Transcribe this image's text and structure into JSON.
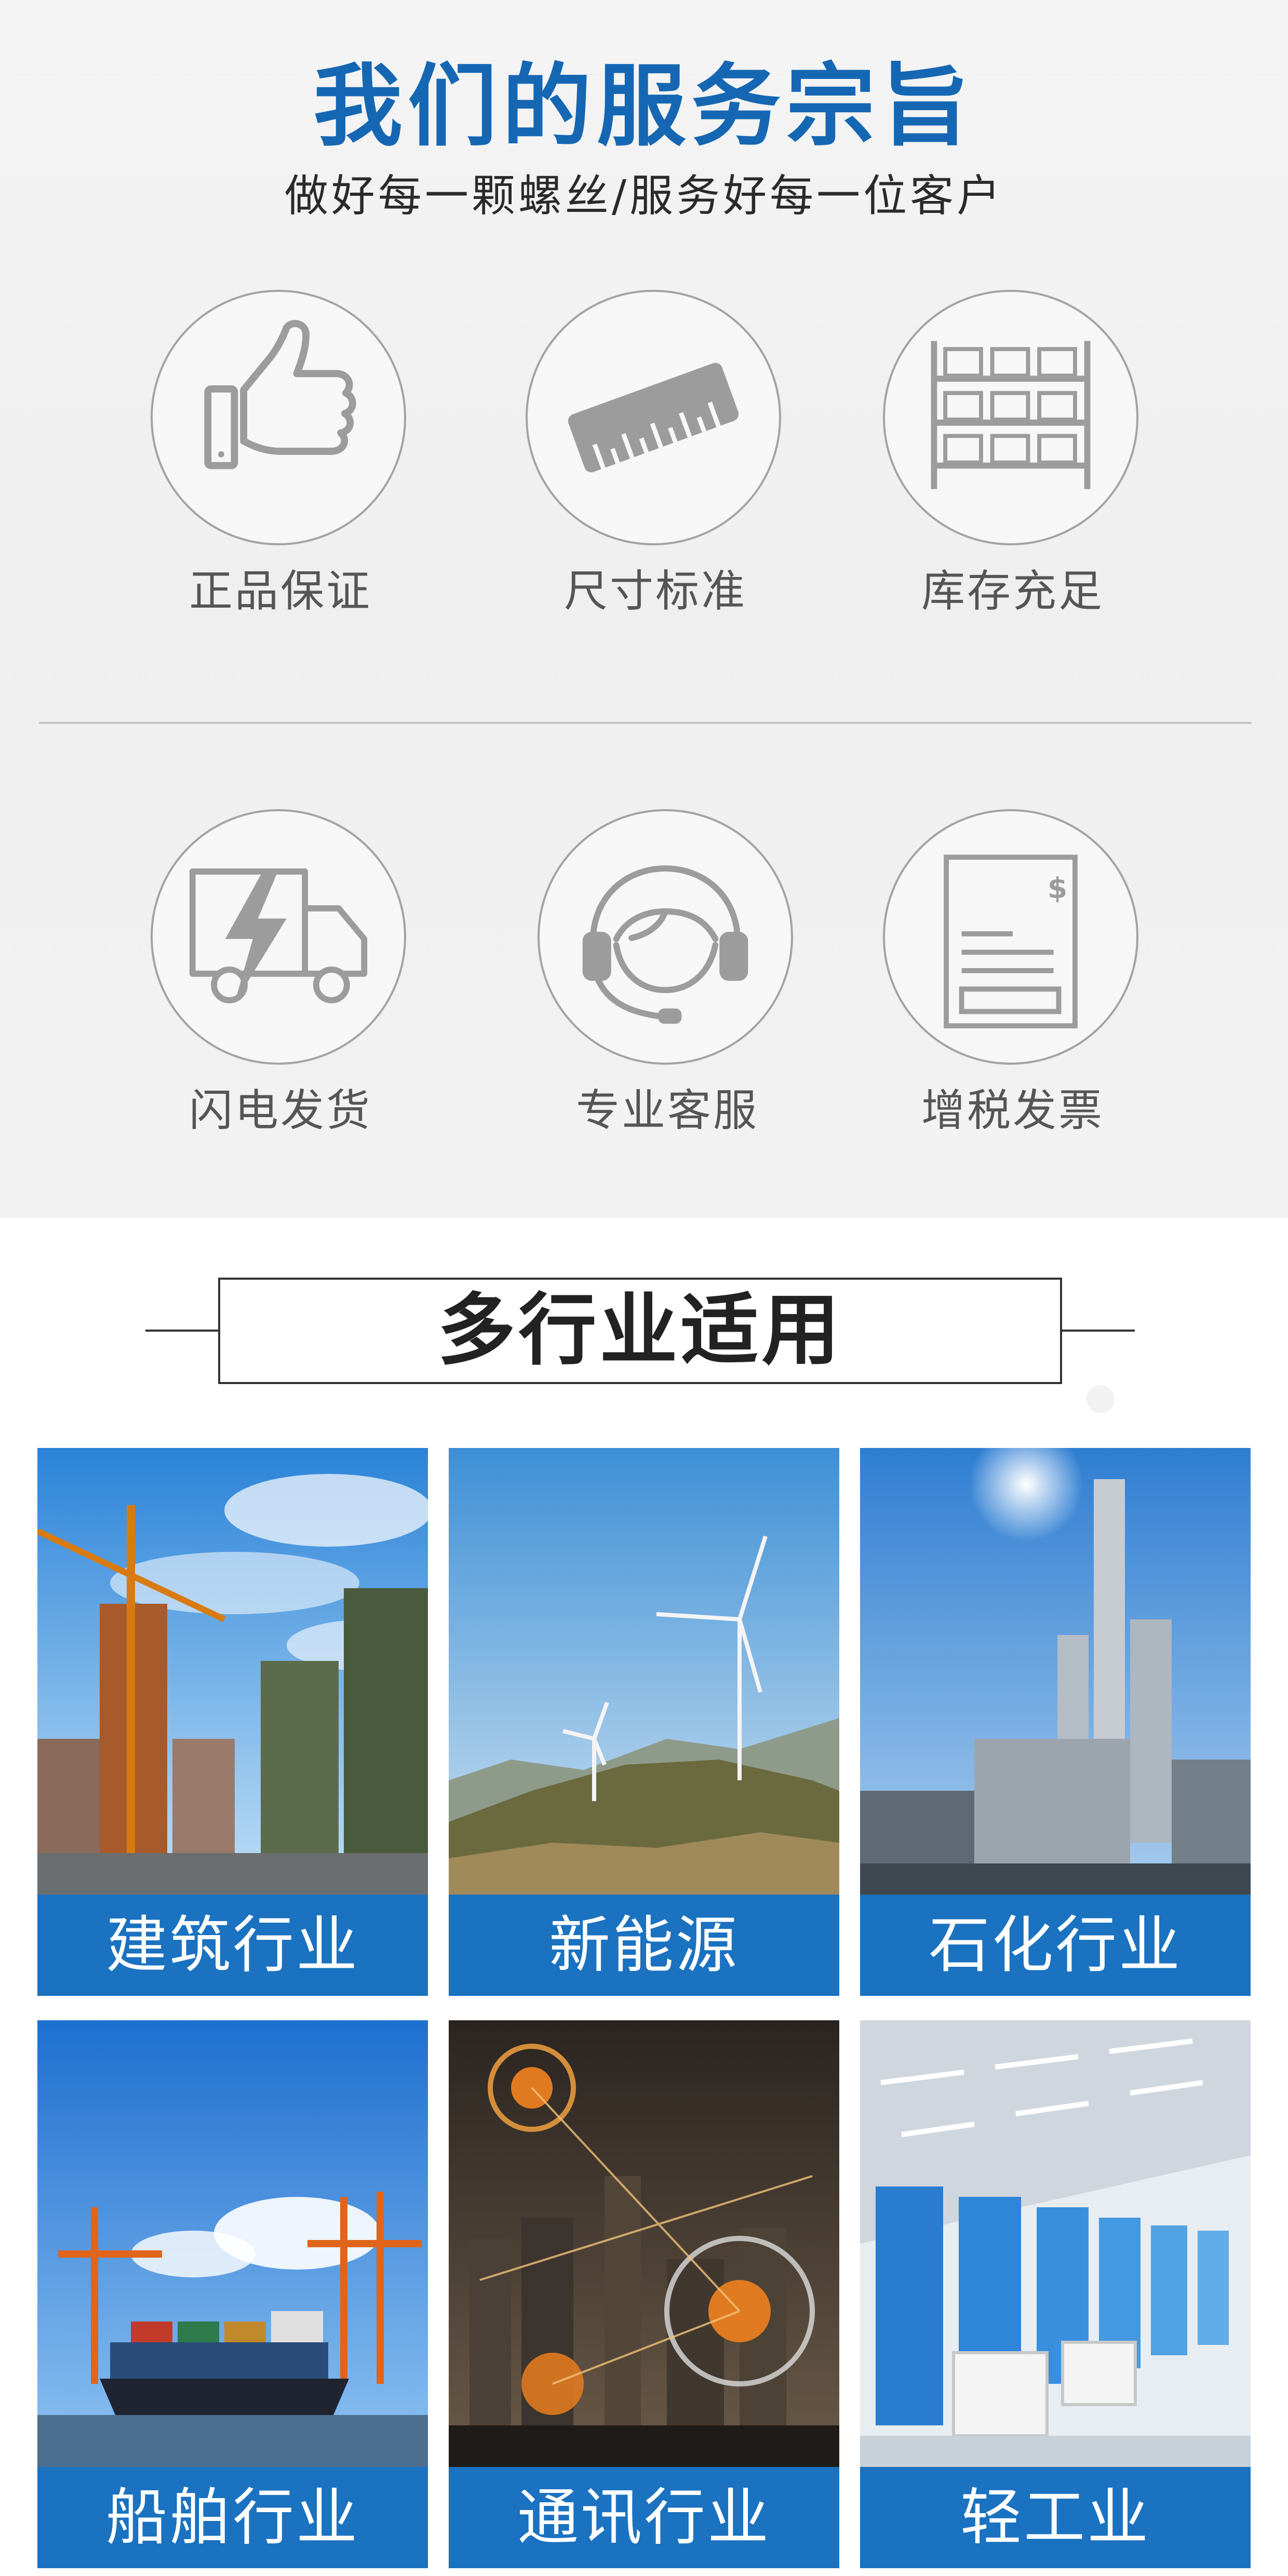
{
  "service": {
    "title": "我们的服务宗旨",
    "subtitle": "做好每一颗螺丝/服务好每一位客户",
    "features": [
      {
        "label": "正品保证",
        "icon": "thumbs-up-icon"
      },
      {
        "label": "尺寸标准",
        "icon": "ruler-icon"
      },
      {
        "label": "库存充足",
        "icon": "warehouse-shelf-icon"
      },
      {
        "label": "闪电发货",
        "icon": "lightning-truck-icon"
      },
      {
        "label": "专业客服",
        "icon": "headset-icon"
      },
      {
        "label": "增税发票",
        "icon": "invoice-icon"
      }
    ]
  },
  "industries": {
    "heading": "多行业适用",
    "items": [
      {
        "label": "建筑行业",
        "image": "construction-crane-photo"
      },
      {
        "label": "新能源",
        "image": "wind-turbine-photo"
      },
      {
        "label": "石化行业",
        "image": "petrochemical-plant-photo"
      },
      {
        "label": "船舶行业",
        "image": "container-ship-port-photo"
      },
      {
        "label": "通讯行业",
        "image": "smart-city-network-photo"
      },
      {
        "label": "轻工业",
        "image": "factory-interior-photo"
      }
    ]
  },
  "colors": {
    "title_blue": "#1567b3",
    "label_bar_blue": "#1a72c0",
    "icon_gray": "#9c9c9c"
  }
}
